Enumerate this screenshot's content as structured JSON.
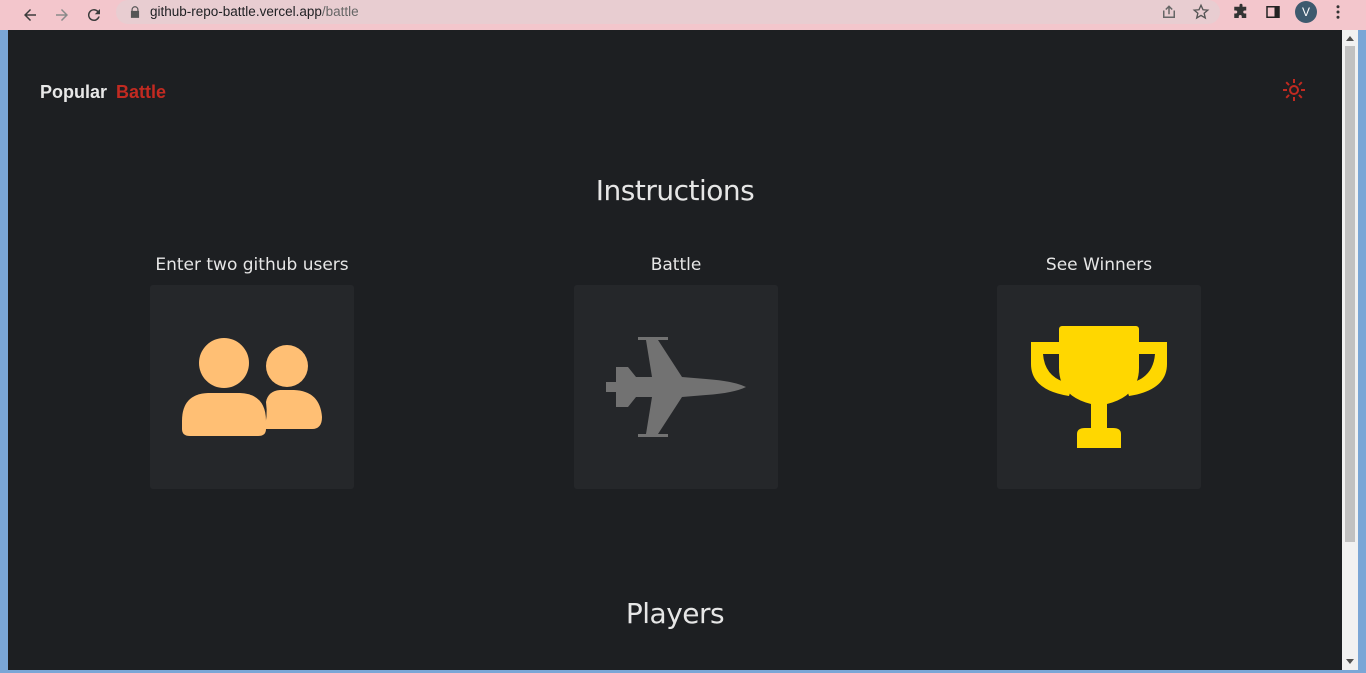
{
  "browser": {
    "url_host": "github-repo-battle.vercel.app",
    "url_path": "/battle",
    "profile_initial": "V",
    "icons": [
      "back-arrow-icon",
      "forward-arrow-icon",
      "reload-icon",
      "lock-icon",
      "share-icon",
      "star-icon",
      "extensions-icon",
      "side-panel-icon",
      "menu-dots-icon"
    ]
  },
  "nav": {
    "popular_label": "Popular",
    "battle_label": "Battle",
    "active": "Battle",
    "active_color": "#c22a21",
    "theme_icon": "sun-icon"
  },
  "instructions": {
    "title": "Instructions",
    "steps": [
      {
        "label": "Enter two github users",
        "icon": "users-icon",
        "color": "#ffbf74"
      },
      {
        "label": "Battle",
        "icon": "fighter-jet-icon",
        "color": "#727272"
      },
      {
        "label": "See Winners",
        "icon": "trophy-icon",
        "color": "#ffd700"
      }
    ]
  },
  "players": {
    "title": "Players"
  }
}
